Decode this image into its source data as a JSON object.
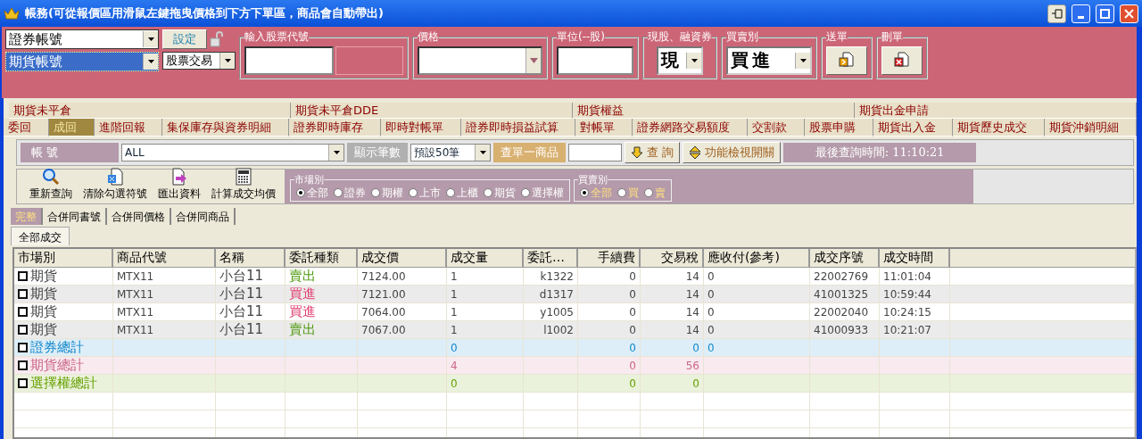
{
  "window": {
    "title": "帳務(可從報價區用滑鼠左鍵拖曳價格到下方下單區，商品會自動帶出)"
  },
  "order_panel": {
    "account_selects": [
      {
        "value": "證券帳號",
        "selected": false
      },
      {
        "value": "期貨帳號",
        "selected": true
      }
    ],
    "set_button": "設定",
    "trade_type": "股票交易",
    "stock_code_label": "輸入股票代號",
    "price_label": "價格",
    "unit_label": "單位(--股)",
    "cash_label": "現股、融資券",
    "cash_value": "現",
    "side_label": "買賣別",
    "side_value": "買進",
    "send_label": "送單",
    "delete_label": "刪單"
  },
  "tabs_row_1": [
    {
      "label": "期貨未平倉",
      "selected": false
    },
    {
      "label": "期貨未平倉DDE",
      "selected": false
    },
    {
      "label": "期貨權益",
      "selected": false
    },
    {
      "label": "期貨出金申請",
      "selected": false
    }
  ],
  "tabs_row_2": [
    {
      "label": "委回",
      "selected": false
    },
    {
      "label": "成回",
      "selected": true
    },
    {
      "label": "進階回報",
      "selected": false
    },
    {
      "label": "集保庫存與資券明細",
      "selected": false
    },
    {
      "label": "證券即時庫存",
      "selected": false
    },
    {
      "label": "即時對帳單",
      "selected": false
    },
    {
      "label": "證券即時損益試算",
      "selected": false
    },
    {
      "label": "對帳單",
      "selected": false
    },
    {
      "label": "證券網路交易額度",
      "selected": false
    },
    {
      "label": "交割款",
      "selected": false
    },
    {
      "label": "股票申購",
      "selected": false
    },
    {
      "label": "期貨出入金",
      "selected": false
    },
    {
      "label": "期貨歷史成交",
      "selected": false
    },
    {
      "label": "期貨沖銷明細",
      "selected": false
    }
  ],
  "query_bar": {
    "account_label": "帳 號",
    "account_value": "ALL",
    "count_label": "顯示筆數",
    "count_value": "預設50筆",
    "single_label": "查單一商品",
    "query_button": "查 詢",
    "toggle_button": "功能檢視開關",
    "last_query": "最後查詢時間: 11:10:21"
  },
  "actions": [
    {
      "label": "重新查詢",
      "kind": "search"
    },
    {
      "label": "清除勾選符號",
      "kind": "clear"
    },
    {
      "label": "匯出資料",
      "kind": "export"
    },
    {
      "label": "計算成交均價",
      "kind": "calc"
    }
  ],
  "market_filter": {
    "title": "市場別",
    "options": [
      {
        "label": "全部",
        "selected": true
      },
      {
        "label": "證券",
        "selected": false
      },
      {
        "label": "期權",
        "selected": false
      },
      {
        "label": "上市",
        "selected": false
      },
      {
        "label": "上櫃",
        "selected": false
      },
      {
        "label": "期貨",
        "selected": false
      },
      {
        "label": "選擇權",
        "selected": false
      }
    ]
  },
  "side_filter": {
    "title": "買賣別",
    "options": [
      {
        "label": "全部",
        "selected": true
      },
      {
        "label": "買",
        "selected": false
      },
      {
        "label": "賣",
        "selected": false
      }
    ]
  },
  "view_tabs": [
    {
      "label": "完整",
      "selected": true
    },
    {
      "label": "合併同書號",
      "selected": false
    },
    {
      "label": "合併同價格",
      "selected": false
    },
    {
      "label": "合併同商品",
      "selected": false
    }
  ],
  "sub_tabs": [
    {
      "label": "全部成交",
      "selected": true
    }
  ],
  "table": {
    "columns": [
      "市場別",
      "商品代號",
      "名稱",
      "委託種類",
      "成交價",
      "成交量",
      "委託…",
      "手續費",
      "交易稅",
      "應收付(參考)",
      "成交序號",
      "成交時間"
    ],
    "rows": [
      {
        "kind": "trade",
        "checked": false,
        "color": "#4f9a10",
        "market": "期貨",
        "code": "MTX11",
        "name": "小台11",
        "order_type": "賣出",
        "price": "7124.00",
        "quantity": "1",
        "order_no": "k1322",
        "fee": "0",
        "tax": "14",
        "receivable": "0",
        "deal_no": "22002769",
        "time": "11:01:04"
      },
      {
        "kind": "trade",
        "checked": false,
        "color": "#e04070",
        "market": "期貨",
        "code": "MTX11",
        "name": "小台11",
        "order_type": "買進",
        "price": "7121.00",
        "quantity": "1",
        "order_no": "d1317",
        "fee": "0",
        "tax": "14",
        "receivable": "0",
        "deal_no": "41001325",
        "time": "10:59:44"
      },
      {
        "kind": "trade",
        "checked": false,
        "color": "#e04070",
        "market": "期貨",
        "code": "MTX11",
        "name": "小台11",
        "order_type": "買進",
        "price": "7064.00",
        "quantity": "1",
        "order_no": "y1005",
        "fee": "0",
        "tax": "14",
        "receivable": "0",
        "deal_no": "22002040",
        "time": "10:24:15"
      },
      {
        "kind": "trade",
        "checked": false,
        "color": "#4f9a10",
        "market": "期貨",
        "code": "MTX11",
        "name": "小台11",
        "order_type": "賣出",
        "price": "7067.00",
        "quantity": "1",
        "order_no": "l1002",
        "fee": "0",
        "tax": "14",
        "receivable": "0",
        "deal_no": "41000933",
        "time": "10:21:07"
      },
      {
        "kind": "total",
        "checked": false,
        "color": "#1188cc",
        "market": "證券總計",
        "quantity": "0",
        "fee": "0",
        "tax": "0",
        "receivable": "0"
      },
      {
        "kind": "total",
        "checked": false,
        "color": "#cc6688",
        "market": "期貨總計",
        "quantity": "4",
        "fee": "0",
        "tax": "56"
      },
      {
        "kind": "total",
        "checked": false,
        "color": "#66a000",
        "market": "選擇權總計",
        "quantity": "0",
        "fee": "0",
        "tax": "0"
      }
    ]
  }
}
